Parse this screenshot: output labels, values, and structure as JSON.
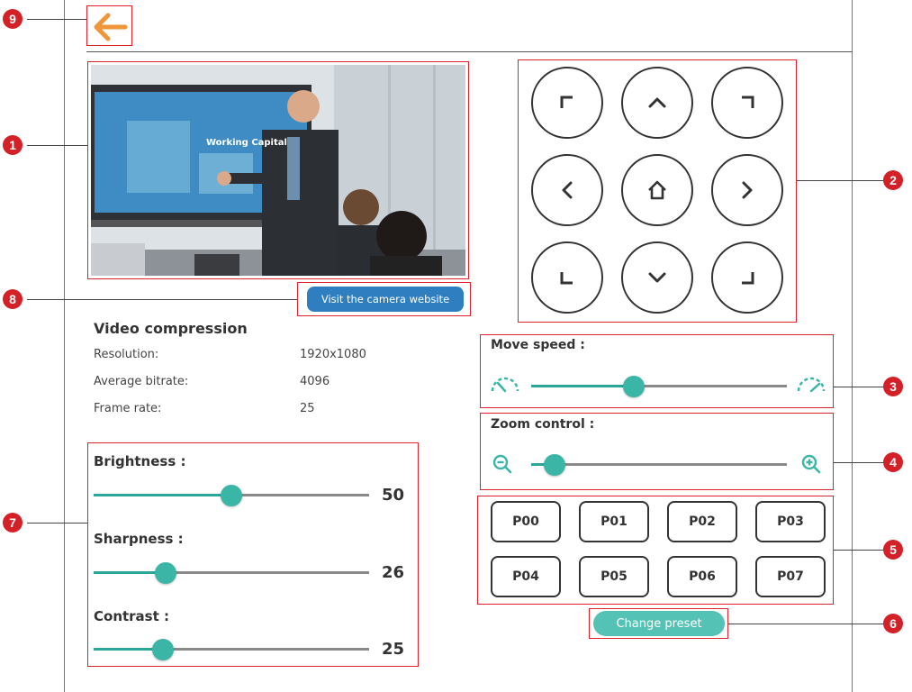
{
  "header": {
    "back_icon": "arrow-left-icon",
    "back_color": "#f0963a"
  },
  "video": {
    "screen_text": "Working Capital"
  },
  "visit_button": {
    "label": "Visit the camera website"
  },
  "video_compression": {
    "title": "Video compression",
    "rows": [
      {
        "label": "Resolution:",
        "value": "1920x1080"
      },
      {
        "label": "Average bitrate:",
        "value": "4096"
      },
      {
        "label": "Frame rate:",
        "value": "25"
      }
    ]
  },
  "image_settings": {
    "brightness": {
      "label": "Brightness :",
      "value": "50",
      "level": 0.5
    },
    "sharpness": {
      "label": "Sharpness :",
      "value": "26",
      "level": 0.26
    },
    "contrast": {
      "label": "Contrast :",
      "value": "25",
      "level": 0.25
    }
  },
  "ptz": {
    "buttons": [
      "up-left",
      "up",
      "up-right",
      "left",
      "home",
      "right",
      "down-left",
      "down",
      "down-right"
    ]
  },
  "move_speed": {
    "label": "Move speed :",
    "level": 0.4,
    "min_icon": "speed-slow-icon",
    "max_icon": "speed-fast-icon"
  },
  "zoom_control": {
    "label": "Zoom control :",
    "level": 0.09,
    "min_icon": "zoom-out-icon",
    "max_icon": "zoom-in-icon"
  },
  "presets": [
    "P00",
    "P01",
    "P02",
    "P03",
    "P04",
    "P05",
    "P06",
    "P07"
  ],
  "change_preset": {
    "label": "Change preset"
  },
  "callouts": [
    "1",
    "2",
    "3",
    "4",
    "5",
    "6",
    "7",
    "8",
    "9"
  ],
  "colors": {
    "accent": "#3bb5a6",
    "callout": "#d42027",
    "link_button": "#2f7fc0"
  }
}
